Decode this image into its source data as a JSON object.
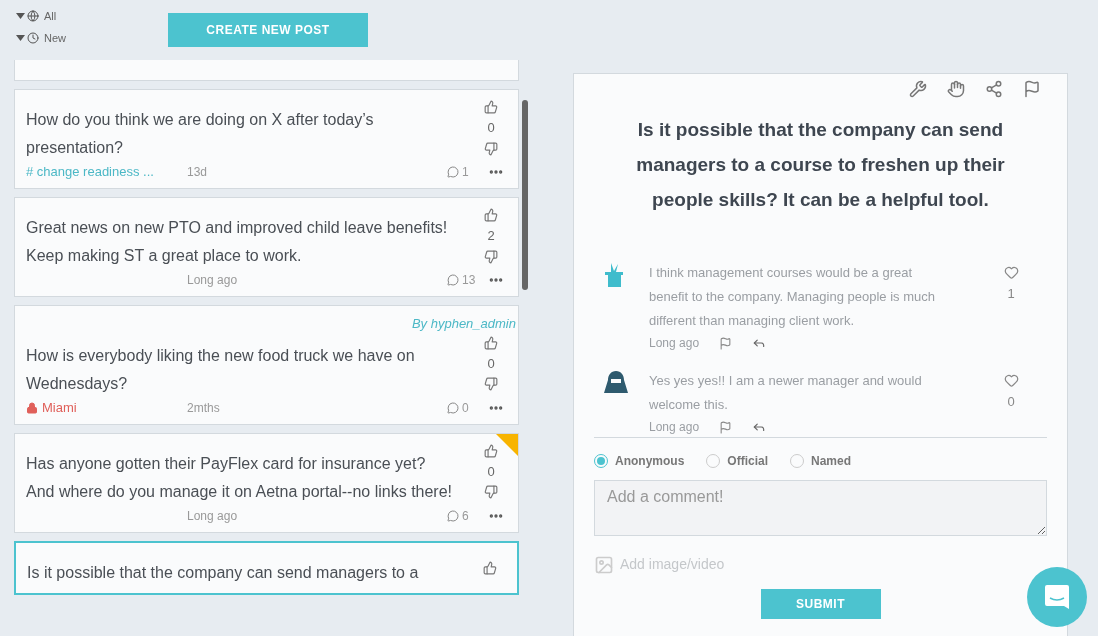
{
  "filters": [
    {
      "kind": "scope",
      "label": "All"
    },
    {
      "kind": "sort",
      "label": "New"
    }
  ],
  "create_button": "CREATE NEW POST",
  "posts": [
    {
      "text": "How do you think we are doing on X after today’s presentation?",
      "tag": {
        "kind": "topic",
        "label": "# change readiness ..."
      },
      "time": "13d",
      "comments": "1",
      "votes": "0",
      "flagged": false,
      "selected": false
    },
    {
      "text": "Great news on new PTO and improved child leave benefits! Keep making ST a great place to work.",
      "time": "Long ago",
      "comments": "13",
      "votes": "2",
      "flagged": false,
      "selected": false
    },
    {
      "author": "By hyphen_admin",
      "text": "How is everybody liking the new food truck we have on Wednesdays?",
      "tag": {
        "kind": "location",
        "label": "Miami"
      },
      "time": "2mths",
      "comments": "0",
      "votes": "0",
      "flagged": false,
      "selected": false
    },
    {
      "text": "Has anyone gotten their PayFlex card for insurance yet? And where do you manage it on Aetna portal--no links there!",
      "time": "Long ago",
      "comments": "6",
      "votes": "0",
      "flagged": true,
      "selected": false
    },
    {
      "text": "Is it possible that the company can send managers to a",
      "flagged": false,
      "selected": true
    }
  ],
  "detail": {
    "title": "Is it possible that the company can send managers to a course to freshen up their people skills? It can be a helpful tool.",
    "comments": [
      {
        "kind": "bunny",
        "text": "I think management courses would be a great benefit to the company. Managing people is much different than managing client work.",
        "time": "Long ago",
        "likes": "1"
      },
      {
        "kind": "person",
        "text": "Yes yes yes!! I am a newer manager and would welcome this.",
        "time": "Long ago",
        "likes": "0"
      }
    ],
    "identity_options": [
      {
        "label": "Anonymous",
        "selected": true
      },
      {
        "label": "Official",
        "selected": false
      },
      {
        "label": "Named",
        "selected": false
      }
    ],
    "comment_placeholder": "Add a comment!",
    "attach_label": "Add image/video",
    "submit": "SUBMIT"
  }
}
